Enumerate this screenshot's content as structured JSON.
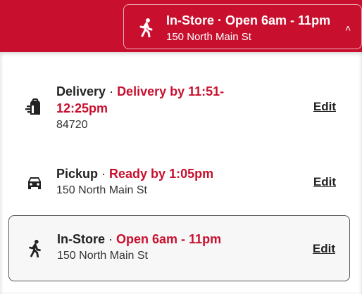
{
  "header": {
    "mode_label": "In-Store",
    "separator": " · ",
    "hours": "Open 6am - 11pm",
    "address": "150 North Main St",
    "chevron": "˄"
  },
  "options": [
    {
      "title": "Delivery",
      "separator": " · ",
      "status": "Delivery by 11:51-12:25pm",
      "detail": "84720",
      "edit_label": "Edit",
      "icon": "delivery-bag-icon"
    },
    {
      "title": "Pickup",
      "separator": " · ",
      "status": "Ready by 1:05pm",
      "detail": "150 North Main St",
      "edit_label": "Edit",
      "icon": "car-icon"
    },
    {
      "title": "In-Store",
      "separator": " · ",
      "status": "Open 6am - 11pm",
      "detail": "150 North Main St",
      "edit_label": "Edit",
      "icon": "walking-person-icon",
      "selected": true
    }
  ],
  "colors": {
    "brand_red": "#c8102e",
    "text": "#222222"
  }
}
